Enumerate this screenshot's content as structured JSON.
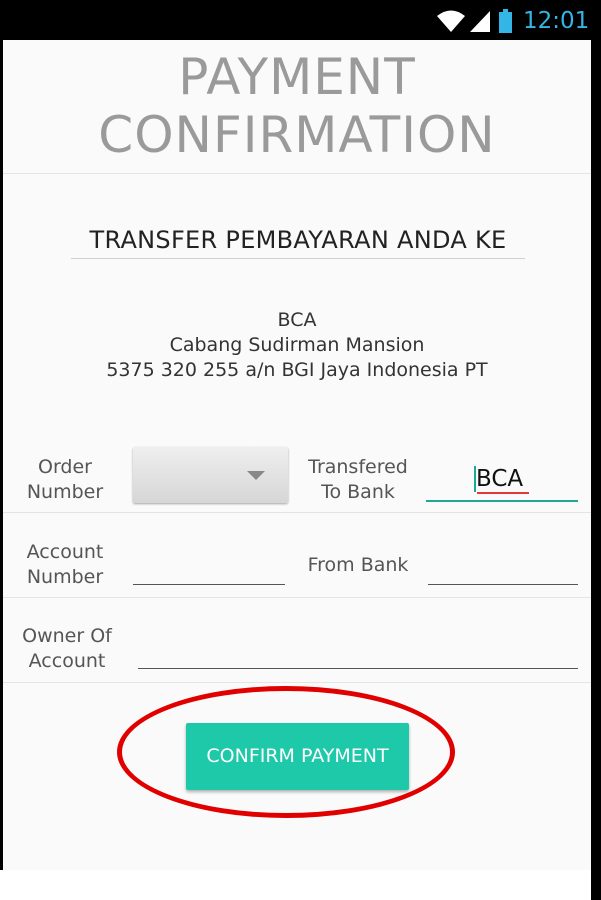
{
  "status_bar": {
    "time": "12:01",
    "icons": [
      "wifi-icon",
      "signal-icon",
      "battery-icon"
    ],
    "accent_color": "#33b5e5"
  },
  "header": {
    "title_line1": "PAYMENT",
    "title_line2": "CONFIRMATION"
  },
  "transfer": {
    "heading": "TRANSFER PEMBAYARAN ANDA KE",
    "bank_name": "BCA",
    "branch": "Cabang Sudirman Mansion",
    "account": "5375 320 255 a/n BGI Jaya Indonesia PT"
  },
  "form": {
    "order_number_label_1": "Order",
    "order_number_label_2": "Number",
    "order_number_value": "",
    "transferred_to_label_1": "Transfered",
    "transferred_to_label_2": "To Bank",
    "transferred_to_value": "BCA",
    "account_number_label_1": "Account",
    "account_number_label_2": "Number",
    "account_number_value": "",
    "from_bank_label": "From Bank",
    "from_bank_value": "",
    "owner_label_1": "Owner Of",
    "owner_label_2": "Account",
    "owner_value": ""
  },
  "actions": {
    "confirm_label": "CONFIRM PAYMENT"
  },
  "colors": {
    "accent_teal": "#1ec9a9",
    "highlight_red": "#e00000",
    "title_gray": "#9a9a9a"
  }
}
